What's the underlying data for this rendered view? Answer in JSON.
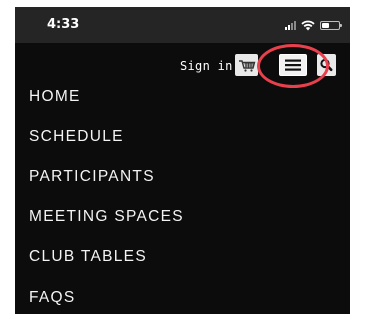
{
  "status_bar": {
    "time": "4:33",
    "battery_level": 0.45,
    "signal_bars_active": 2,
    "signal_bars_total": 4
  },
  "header": {
    "sign_in_label": "Sign in",
    "cart_icon": "shopping-cart-icon",
    "menu_icon": "hamburger-menu-icon",
    "search_icon": "search-icon",
    "highlight_color": "#e8404c"
  },
  "nav": {
    "items": [
      {
        "label": "HOME"
      },
      {
        "label": "SCHEDULE"
      },
      {
        "label": "PARTICIPANTS"
      },
      {
        "label": "MEETING SPACES"
      },
      {
        "label": "CLUB TABLES"
      },
      {
        "label": "FAQS"
      }
    ]
  },
  "colors": {
    "background": "#0c0c0c",
    "status_bar": "#252525",
    "text": "#f4f4f4"
  }
}
